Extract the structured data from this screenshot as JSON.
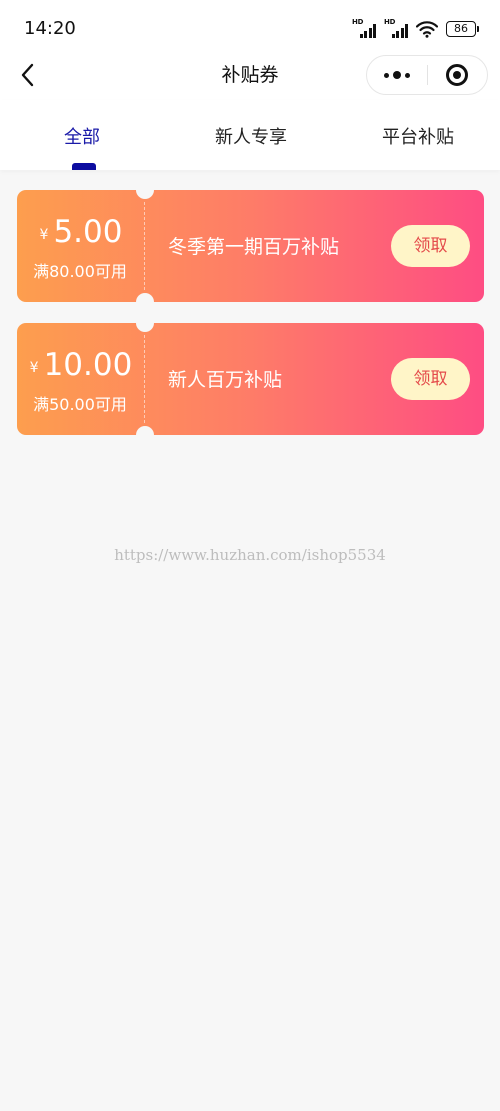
{
  "status_bar": {
    "time": "14:20",
    "signal_1_label": "HD",
    "signal_2_label": "HD",
    "battery_level": "86",
    "icons": [
      "signal-icon",
      "signal-icon",
      "wifi-icon",
      "battery-icon"
    ]
  },
  "nav": {
    "title": "补贴券",
    "back_icon": "chevron-left-icon",
    "more_icon": "more-dots-icon",
    "close_icon": "target-icon"
  },
  "tabs": [
    {
      "label": "全部",
      "active": true
    },
    {
      "label": "新人专享",
      "active": false
    },
    {
      "label": "平台补贴",
      "active": false
    }
  ],
  "coupons": [
    {
      "currency": "¥",
      "amount": "5.00",
      "condition": "满80.00可用",
      "name": "冬季第一期百万补贴",
      "action": "领取"
    },
    {
      "currency": "¥",
      "amount": "10.00",
      "condition": "满50.00可用",
      "name": "新人百万补贴",
      "action": "领取"
    }
  ],
  "watermark": "https://www.huzhan.com/ishop5534",
  "colors": {
    "active_tab": "#1a1aa8",
    "coupon_gradient_start": "#fd9e4e",
    "coupon_gradient_end": "#fe4d83",
    "claim_button_bg": "#fff5c8",
    "claim_button_text": "#e44a4a",
    "page_bg": "#f7f7f7"
  }
}
